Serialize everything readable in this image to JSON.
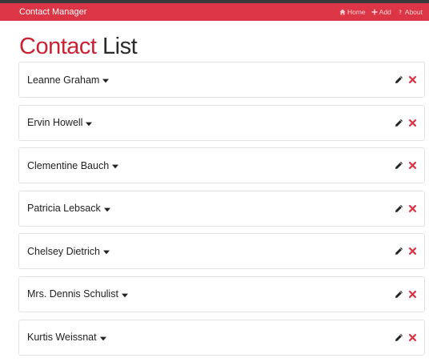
{
  "navbar": {
    "brand": "Contact Manager",
    "links": [
      {
        "label": "Home",
        "icon": "home-icon"
      },
      {
        "label": "Add",
        "icon": "plus-icon"
      },
      {
        "label": "About",
        "icon": "question-icon"
      }
    ]
  },
  "page": {
    "title_accent": "Contact",
    "title_rest": "List"
  },
  "contacts": [
    {
      "name": "Leanne Graham"
    },
    {
      "name": "Ervin Howell"
    },
    {
      "name": "Clementine Bauch"
    },
    {
      "name": "Patricia Lebsack"
    },
    {
      "name": "Chelsey Dietrich"
    },
    {
      "name": "Mrs. Dennis Schulist"
    },
    {
      "name": "Kurtis Weissnat"
    }
  ],
  "colors": {
    "navbar": "#dc3545",
    "accent": "#c82333",
    "delete": "#dc3545"
  }
}
